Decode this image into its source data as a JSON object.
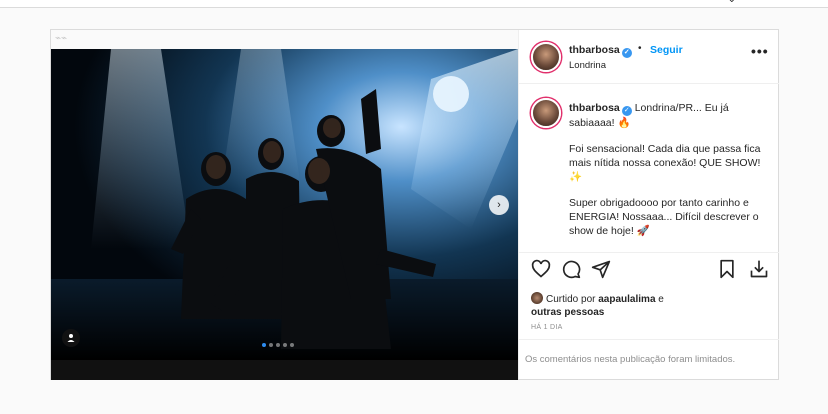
{
  "post": {
    "username": "thbarbosa",
    "follow_label": "Seguir",
    "separator": "•",
    "location": "Londrina",
    "more_label": "•••",
    "caption": {
      "username": "thbarbosa",
      "line1": "Londrina/PR... Eu já sabiaaaa! 🔥",
      "para2": "Foi sensacional! Cada dia que passa fica mais nítida nossa conexão! QUE SHOW! ✨",
      "para3": "Super obrigadoooo por tanto carinho e ENERGIA! Nossaaa... Difícil descrever o show de hoje! 🚀"
    },
    "likes": {
      "prefix": "Curtido por",
      "user": "aapaulalima",
      "conj": "e",
      "others": "outras pessoas"
    },
    "time_ago": "HÁ 1 DIA",
    "comments_limited": "Os comentários nesta publicação foram limitados."
  },
  "carousel": {
    "slides_total": 5,
    "current_slide": 1
  },
  "icons": {
    "more": "more-options-icon",
    "like": "heart-icon",
    "comment": "comment-icon",
    "share": "send-icon",
    "save": "bookmark-icon",
    "download": "download-icon",
    "next": "chevron-right-icon",
    "tag": "user-tag-icon"
  },
  "colors": {
    "link": "#0095f6",
    "verified": "#3897f0",
    "carousel_active_dot": "#2d8cf0"
  }
}
